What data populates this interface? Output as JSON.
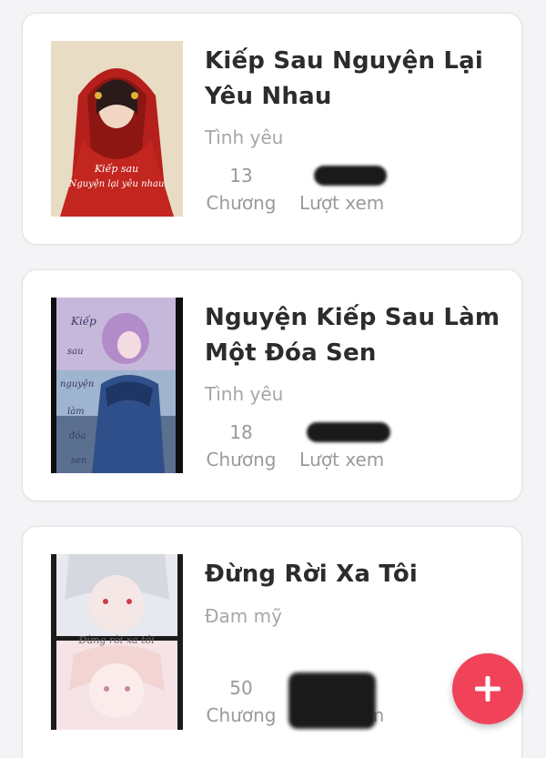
{
  "stories": [
    {
      "title": "Kiếp Sau Nguyện Lại Yêu Nhau",
      "genre": "Tình yêu",
      "chapters": "13",
      "chapters_label": "Chương",
      "views_label": "Lượt xem",
      "cover_text": [
        "Kiếp sau",
        "Nguyện lại yêu nhau"
      ]
    },
    {
      "title": "Nguyện Kiếp Sau Làm Một Đóa Sen",
      "genre": "Tình yêu",
      "chapters": "18",
      "chapters_label": "Chương",
      "views_label": "Lượt xem",
      "cover_text": [
        "Kiếp",
        "sau",
        "nguyện",
        "làm",
        "đóa",
        "sen"
      ]
    },
    {
      "title": "Đừng Rời Xa Tôi",
      "genre": "Đam mỹ",
      "chapters": "50",
      "chapters_label": "Chương",
      "views_label": "Lượt xem",
      "cover_text": [
        "Đừng rời xa tôi"
      ]
    }
  ],
  "fab": {
    "icon": "plus-icon",
    "color": "#f0435a"
  },
  "colors": {
    "title": "#2c2c2c",
    "muted": "#9a9a9a",
    "card_border": "#e2e2e6"
  }
}
